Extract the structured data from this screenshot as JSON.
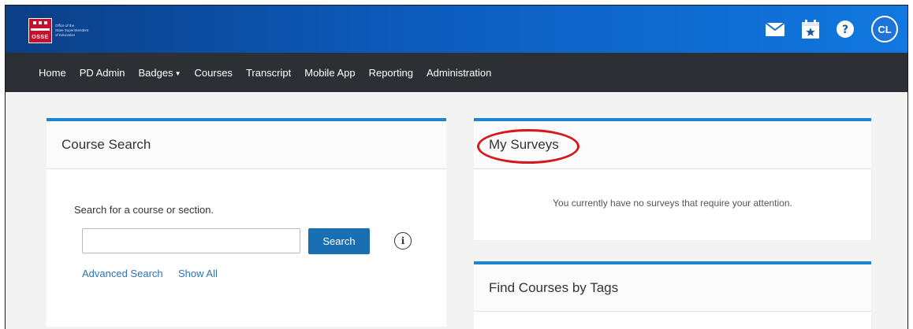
{
  "header": {
    "logo": {
      "abbrev": "OSSE",
      "lines": [
        "Office of the",
        "State Superintendent",
        "of Education"
      ]
    },
    "icons": [
      "mail-icon",
      "calendar-star-icon",
      "help-icon"
    ],
    "avatar_initials": "CL",
    "brand_color": "#0d5bbd"
  },
  "nav": {
    "items": [
      "Home",
      "PD Admin",
      "Badges",
      "Courses",
      "Transcript",
      "Mobile App",
      "Reporting",
      "Administration"
    ]
  },
  "course_search": {
    "title": "Course Search",
    "label": "Search for a course or section.",
    "input_value": "",
    "button": "Search",
    "advanced_link": "Advanced Search",
    "show_all_link": "Show All"
  },
  "surveys": {
    "title": "My Surveys",
    "message": "You currently have no surveys that require your attention.",
    "highlight_color": "#d7151b"
  },
  "tags": {
    "title": "Find Courses by Tags"
  },
  "colors": {
    "accent": "#1a86d0",
    "button": "#1a6fb2",
    "navbar": "#2c3035"
  }
}
